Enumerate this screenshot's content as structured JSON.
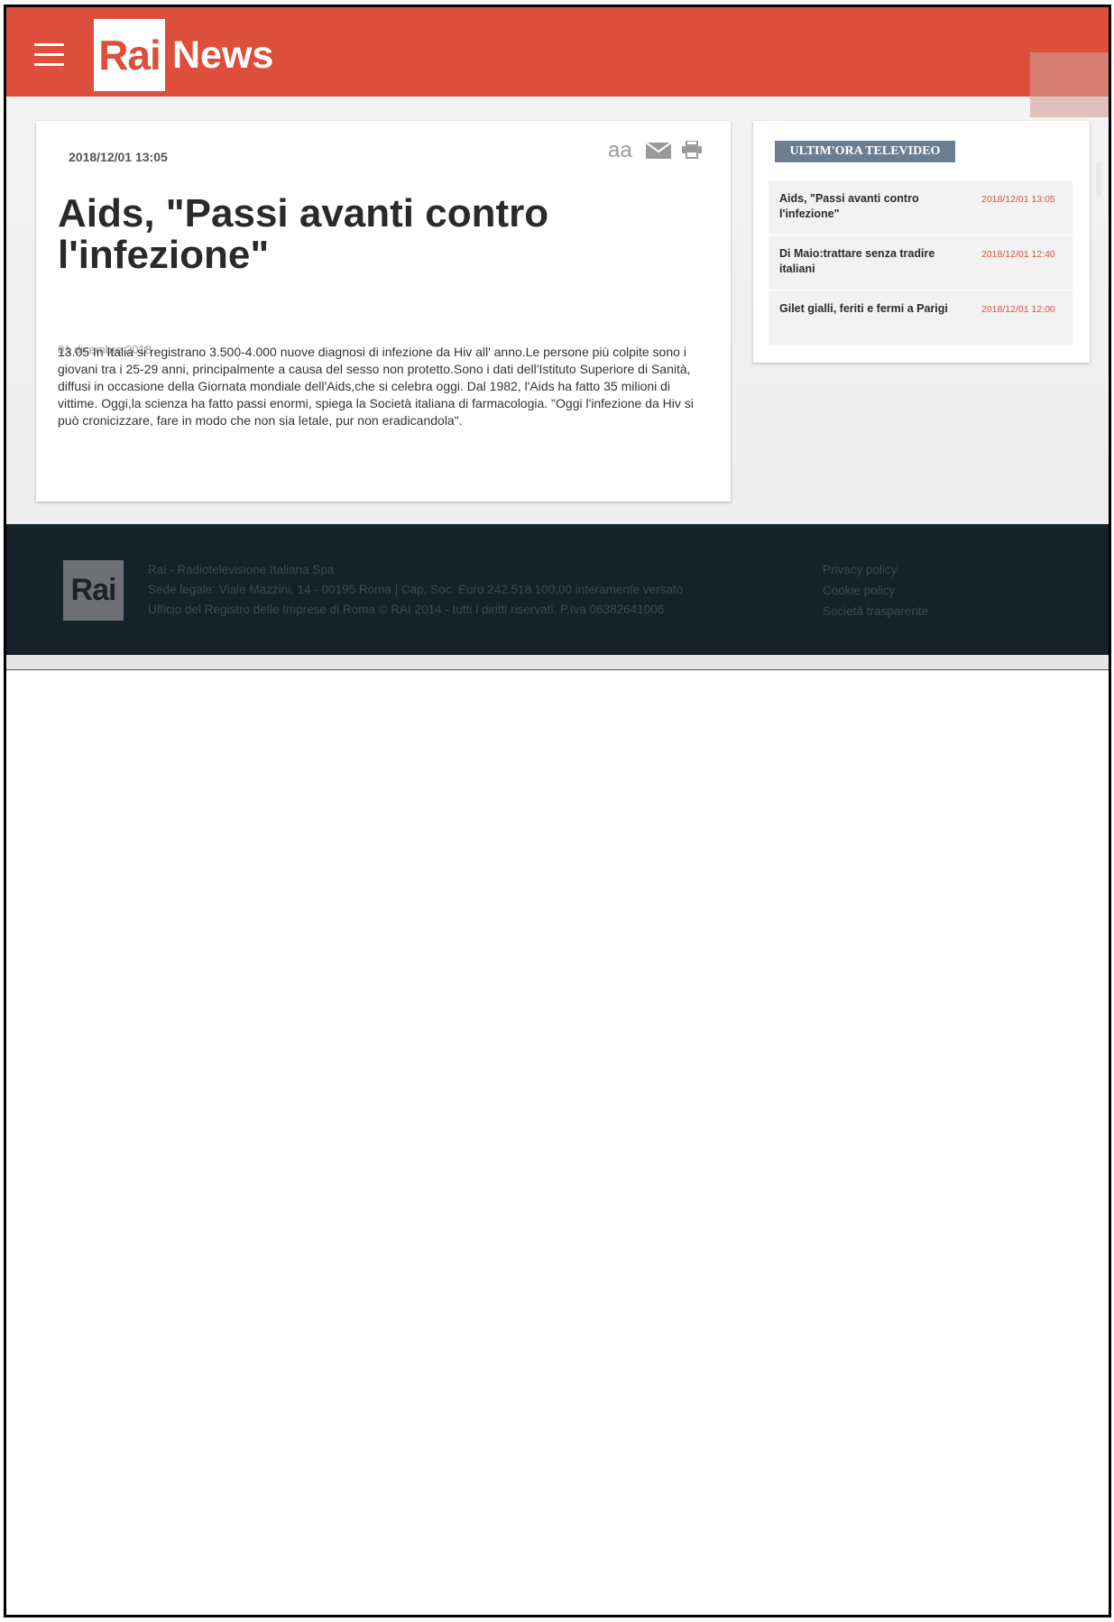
{
  "header": {
    "logo_rai": "Rai",
    "logo_news": "News"
  },
  "article": {
    "date": "2018/12/01 13:05",
    "tools": {
      "text_size_label": "aa"
    },
    "title": "Aids, \"Passi avanti contro l'infezione\"",
    "ghost_date": "01 dicembre 2018",
    "body": "13.05 In Italia si registrano 3.500-4.000 nuove diagnosi di infezione da Hiv all' anno.Le persone più colpite sono i giovani tra i 25-29 anni, principalmente a causa del sesso non protetto.Sono i dati dell'Istituto Superiore di Sanità, diffusi in occasione della Giornata mondiale dell'Aids,che si celebra oggi. Dal 1982, l'Aids ha fatto 35 milioni di vittime. Oggi,la scienza ha fatto passi enormi, spiega la Società italiana di farmacologia. \"Oggi l'infezione da Hiv si può cronicizzare, fare in modo che non sia letale, pur non eradicandola\"."
  },
  "sidebar": {
    "title": "ULTIM'ORA TELEVIDEO",
    "items": [
      {
        "title": "Aids, \"Passi avanti contro l'infezione\"",
        "time": "2018/12/01 13:05"
      },
      {
        "title": "Di Maio:trattare senza tradire italiani",
        "time": "2018/12/01 12:40"
      },
      {
        "title": "Gilet gialli, feriti e fermi a Parigi",
        "time": "2018/12/01 12:00"
      }
    ]
  },
  "footer": {
    "logo": "Rai",
    "lines": [
      "Rai - Radiotelevisione Italiana Spa",
      "Sede legale: Viale Mazzini, 14 - 00195 Roma | Cap. Soc. Euro 242.518.100,00 interamente versato",
      "Ufficio del Registro delle Imprese di Roma © RAI 2014 - tutti i diritti riservati. P.Iva 06382641006"
    ],
    "links": [
      "Privacy policy",
      "Cookie policy",
      "Società trasparente"
    ]
  },
  "colors": {
    "brand": "#dd4e3b",
    "footer_bg": "#16222a",
    "sidebar_title_bg": "#6c7f91",
    "time_color": "#d4543f"
  },
  "icons": [
    "menu-icon",
    "text-size-icon",
    "mail-icon",
    "print-icon"
  ]
}
